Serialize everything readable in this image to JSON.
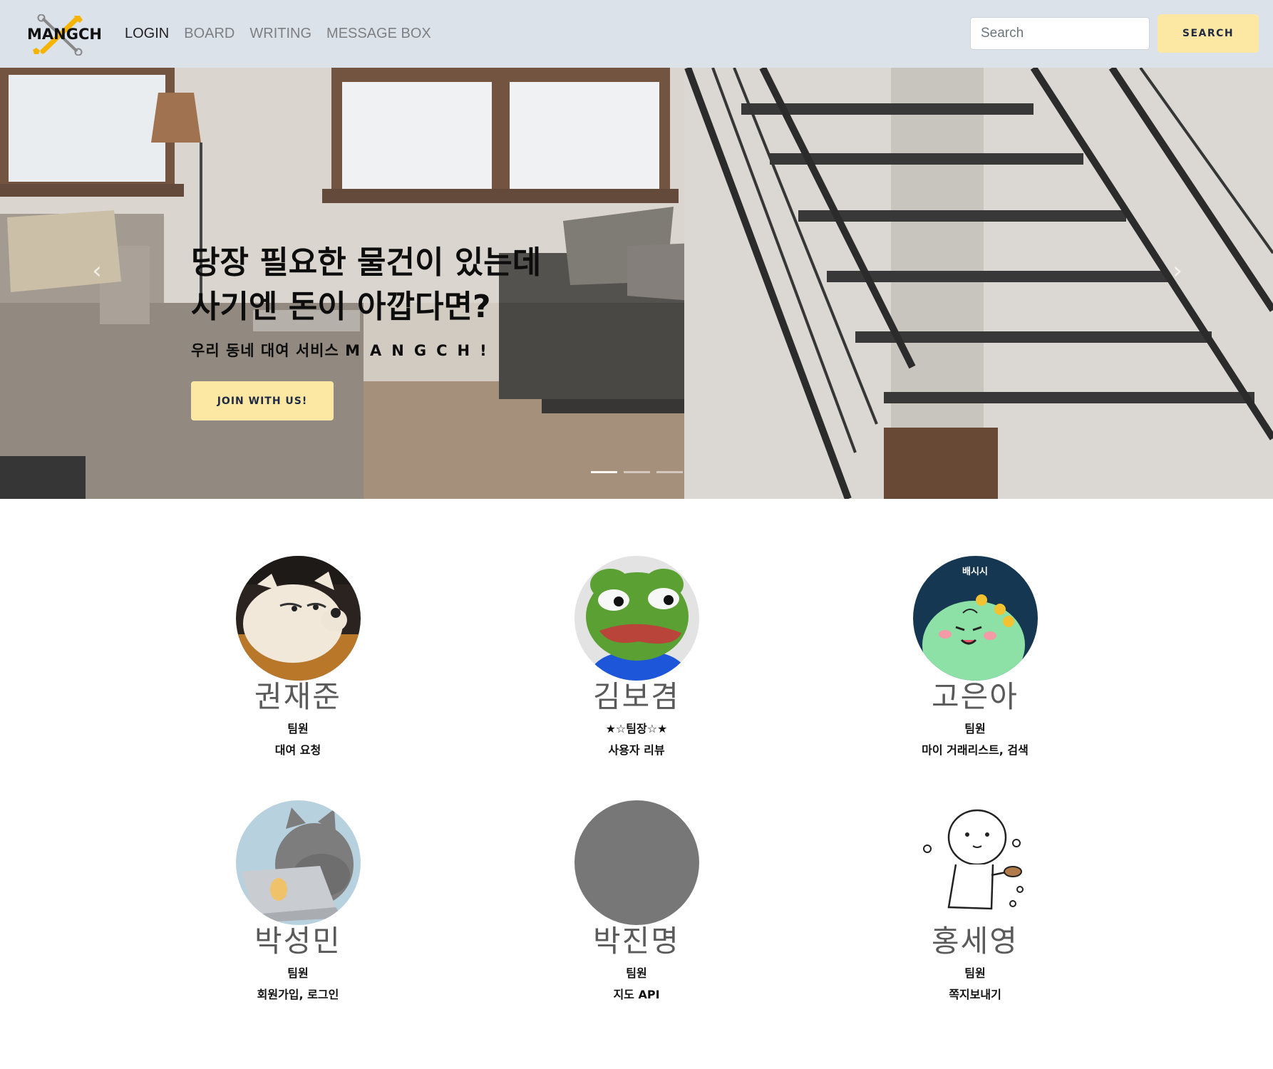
{
  "nav": {
    "logo_text": "MANGCH",
    "links": [
      "LOGIN",
      "BOARD",
      "WRITING",
      "MESSAGE BOX"
    ],
    "search_placeholder": "Search",
    "search_button": "SEARCH"
  },
  "hero": {
    "title": "당장 필요한 물건이 있는데\n사기엔 돈이 아깝다면?",
    "subtitle_prefix": "우리 동네 대여 서비스 ",
    "subtitle_brand": "MANGCH!",
    "button": "JOIN WITH US!",
    "prev_glyph": "‹",
    "next_glyph": "›",
    "slide_count": 3,
    "active_slide": 0
  },
  "team": [
    {
      "name": "권재준",
      "role": "팀원",
      "task": "대여 요청",
      "avatar": "dog-avatar"
    },
    {
      "name": "김보겸",
      "role": "★☆팀장☆★",
      "task": "사용자 리뷰",
      "avatar": "frog-avatar"
    },
    {
      "name": "고은아",
      "role": "팀원",
      "task": "마이 거래리스트, 검색",
      "avatar": "dino-avatar",
      "avatar_caption": "배시시"
    },
    {
      "name": "박성민",
      "role": "팀원",
      "task": "회원가입, 로그인",
      "avatar": "cat-avatar"
    },
    {
      "name": "박진명",
      "role": "팀원",
      "task": "지도 API",
      "avatar": "gray-avatar"
    },
    {
      "name": "홍세영",
      "role": "팀원",
      "task": "쪽지보내기",
      "avatar": "doodle-avatar"
    }
  ],
  "colors": {
    "navbar_bg": "#dce2ea",
    "button_yellow": "#fde8a3",
    "button_text": "#1f2a44",
    "name_gray": "#5a5a5a"
  }
}
